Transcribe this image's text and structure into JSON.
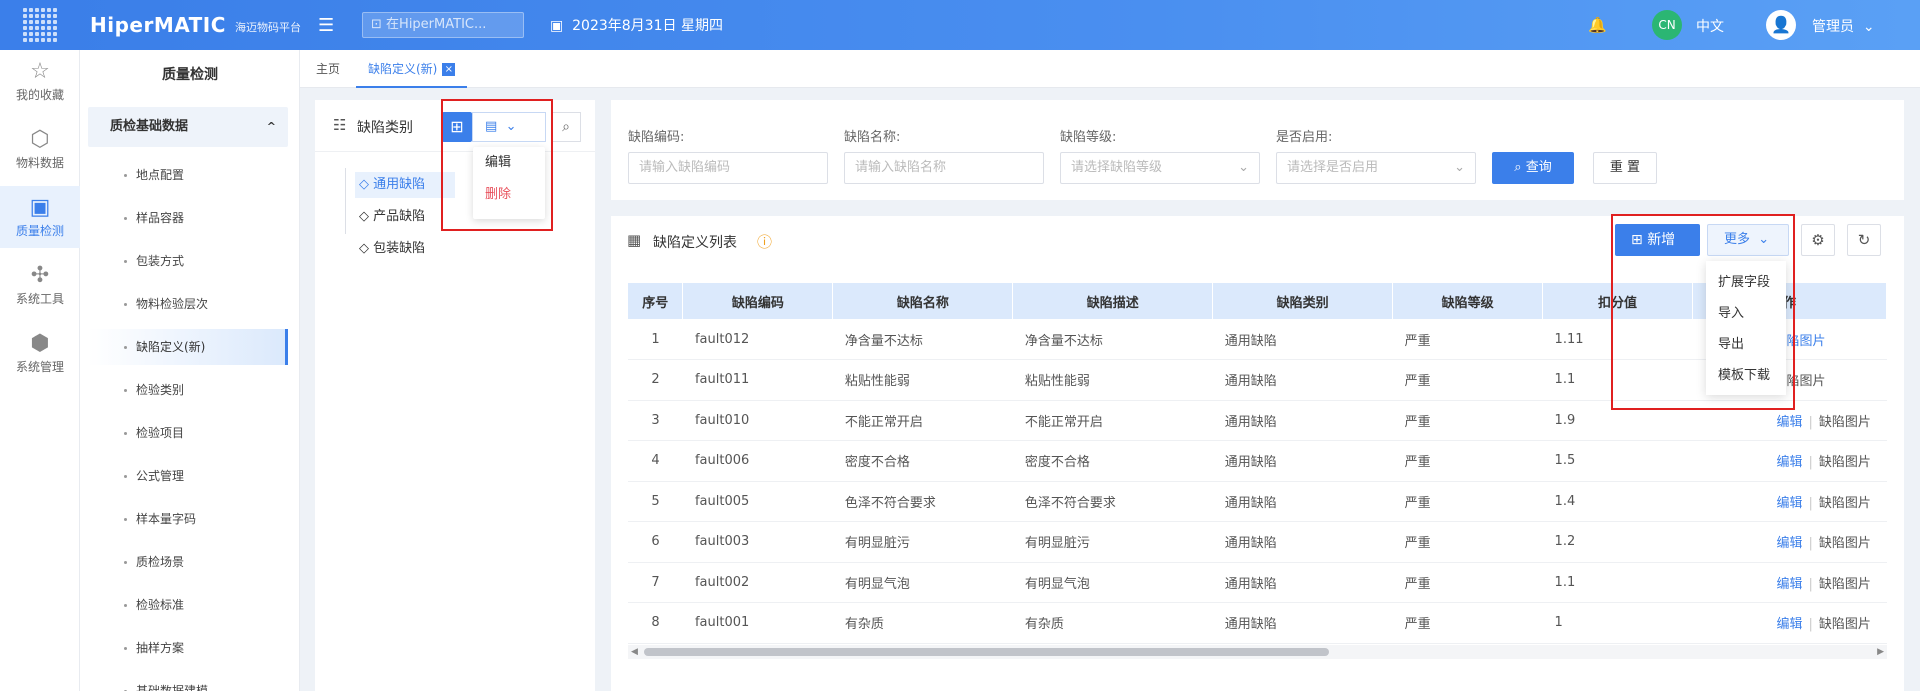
{
  "app": {
    "logo": "HiperMATIC",
    "logo_sub": "海迈物码平台",
    "search_placeholder": "在HiperMATIC...",
    "date": "2023年8月31日 星期四",
    "lang_badge": "CN",
    "lang": "中文",
    "user": "管理员"
  },
  "rail": [
    "我的收藏",
    "物料数据",
    "质量检测",
    "系统工具",
    "系统管理"
  ],
  "sidebar": {
    "title": "质量检测",
    "group": "质检基础数据",
    "items": [
      "地点配置",
      "样品容器",
      "包装方式",
      "物料检验层次",
      "缺陷定义(新)",
      "检验类别",
      "检验项目",
      "公式管理",
      "样本量字码",
      "质检场景",
      "检验标准",
      "抽样方案",
      "基础数据建模"
    ]
  },
  "tabs": {
    "home": "主页",
    "current": "缺陷定义(新)",
    "close": "×"
  },
  "left_panel": {
    "title": "缺陷类别",
    "dropdown": {
      "edit": "编辑",
      "delete": "删除"
    },
    "tree": [
      "通用缺陷",
      "产品缺陷",
      "包装缺陷"
    ]
  },
  "filter": {
    "code_label": "缺陷编码:",
    "code_placeholder": "请输入缺陷编码",
    "name_label": "缺陷名称:",
    "name_placeholder": "请输入缺陷名称",
    "level_label": "缺陷等级:",
    "level_placeholder": "请选择缺陷等级",
    "enabled_label": "是否启用:",
    "enabled_placeholder": "请选择是否启用",
    "query": "查询",
    "reset": "重 置"
  },
  "table_panel": {
    "title": "缺陷定义列表",
    "new_btn": "新增",
    "more_btn": "更多",
    "more_menu": [
      "扩展字段",
      "导入",
      "导出",
      "模板下载"
    ],
    "columns": [
      "序号",
      "缺陷编码",
      "缺陷名称",
      "缺陷描述",
      "缺陷类别",
      "缺陷等级",
      "扣分值",
      "作"
    ],
    "rows": [
      [
        "1",
        "fault012",
        "净含量不达标",
        "净含量不达标",
        "通用缺陷",
        "严重",
        "1.11"
      ],
      [
        "2",
        "fault011",
        "粘贴性能弱",
        "粘贴性能弱",
        "通用缺陷",
        "严重",
        "1.1"
      ],
      [
        "3",
        "fault010",
        "不能正常开启",
        "不能正常开启",
        "通用缺陷",
        "严重",
        "1.9"
      ],
      [
        "4",
        "fault006",
        "密度不合格",
        "密度不合格",
        "通用缺陷",
        "严重",
        "1.5"
      ],
      [
        "5",
        "fault005",
        "色泽不符合要求",
        "色泽不符合要求",
        "通用缺陷",
        "严重",
        "1.4"
      ],
      [
        "6",
        "fault003",
        "有明显脏污",
        "有明显脏污",
        "通用缺陷",
        "严重",
        "1.2"
      ],
      [
        "7",
        "fault002",
        "有明显气泡",
        "有明显气泡",
        "通用缺陷",
        "严重",
        "1.1"
      ],
      [
        "8",
        "fault001",
        "有杂质",
        "有杂质",
        "通用缺陷",
        "严重",
        "1"
      ]
    ],
    "action_edit": "编辑",
    "action_image": "缺陷图片",
    "partial_image": "陷图片"
  },
  "colors": {
    "primary": "#3b7fea",
    "highlight_box": "#e02020",
    "delete_text": "#e8505b"
  }
}
